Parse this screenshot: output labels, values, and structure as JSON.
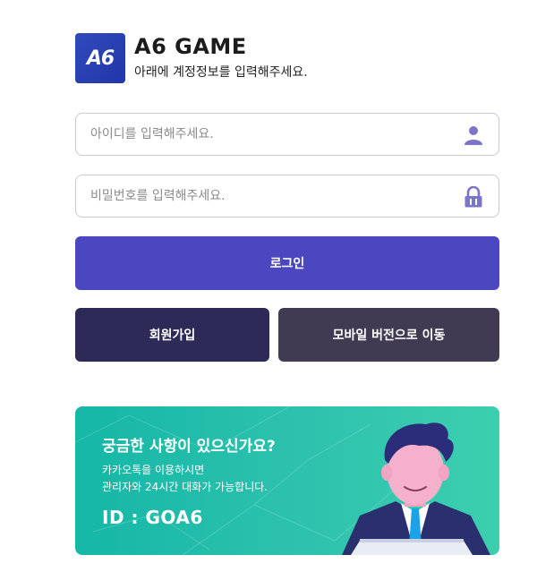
{
  "header": {
    "logo_text": "A6",
    "title": "A6 GAME",
    "subtitle": "아래에 계정정보를 입력해주세요."
  },
  "form": {
    "id_placeholder": "아이디를 입력해주세요.",
    "password_placeholder": "비밀번호를 입력해주세요.",
    "id_icon": "user-icon",
    "password_icon": "lock-icon"
  },
  "buttons": {
    "login": "로그인",
    "signup": "회원가입",
    "mobile": "모바일 버전으로 이동"
  },
  "banner": {
    "title": "궁금한 사항이 있으신가요?",
    "line1": "카카오톡을 이용하시면",
    "line2": "관리자와 24시간 대화가 가능합니다.",
    "id_text": "ID : GOA6",
    "illustration": "support-agent-illustration"
  },
  "colors": {
    "login_button": "#4b47c0",
    "signup_button": "#2e2a58",
    "mobile_button": "#403b52",
    "banner_start": "#15b7a6",
    "banner_end": "#3ccfae",
    "logo": "#2f4bbd",
    "icon": "#7b75c8"
  }
}
